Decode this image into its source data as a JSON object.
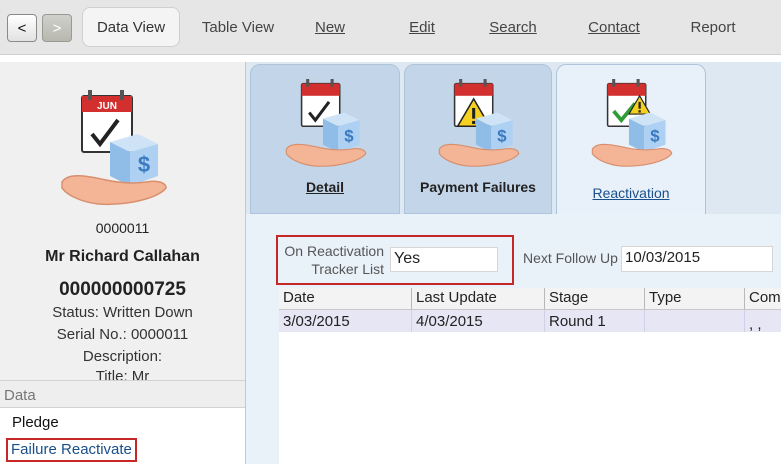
{
  "toolbar": {
    "back_glyph": "<",
    "forward_glyph": ">",
    "items": [
      {
        "label": "Data View"
      },
      {
        "label": "Table View"
      },
      {
        "label": "New"
      },
      {
        "label": "Edit"
      },
      {
        "label": "Search"
      },
      {
        "label": "Contact"
      },
      {
        "label": "Report"
      }
    ]
  },
  "record": {
    "id": "0000011",
    "name": "Mr Richard Callahan",
    "number": "000000000725",
    "status": "Status: Written Down",
    "serial": "Serial No.: 0000011",
    "description": "Description:",
    "title": "Title: Mr"
  },
  "icon_calendar_text": "JUN",
  "data_section": {
    "header": "Data",
    "items": [
      {
        "label": "Pledge"
      },
      {
        "label": "Failure Reactivate"
      }
    ]
  },
  "tabs": [
    {
      "label": "Detail",
      "icon": "calendar-check-money-icon"
    },
    {
      "label": "Payment Failures",
      "icon": "calendar-warning-money-icon"
    },
    {
      "label": "Reactivation",
      "icon": "calendar-green-check-warning-icon"
    }
  ],
  "form": {
    "on_reactivation_label_1": "On Reactivation",
    "on_reactivation_label_2": "Tracker List",
    "on_reactivation_value": "Yes",
    "next_follow_up_label": "Next Follow Up",
    "next_follow_up_value": "10/03/2015"
  },
  "grid": {
    "columns": [
      "Date",
      "Last Update",
      "Stage",
      "Type",
      "Com"
    ],
    "rows": [
      {
        "date": "3/03/2015",
        "last_update": "4/03/2015",
        "stage": "Round 1",
        "type": "",
        "com": ", ,"
      }
    ]
  },
  "colors": {
    "highlight_border": "#c62828",
    "active_tab_text": "#1a4f8a",
    "link_text": "#1a4f8a"
  }
}
